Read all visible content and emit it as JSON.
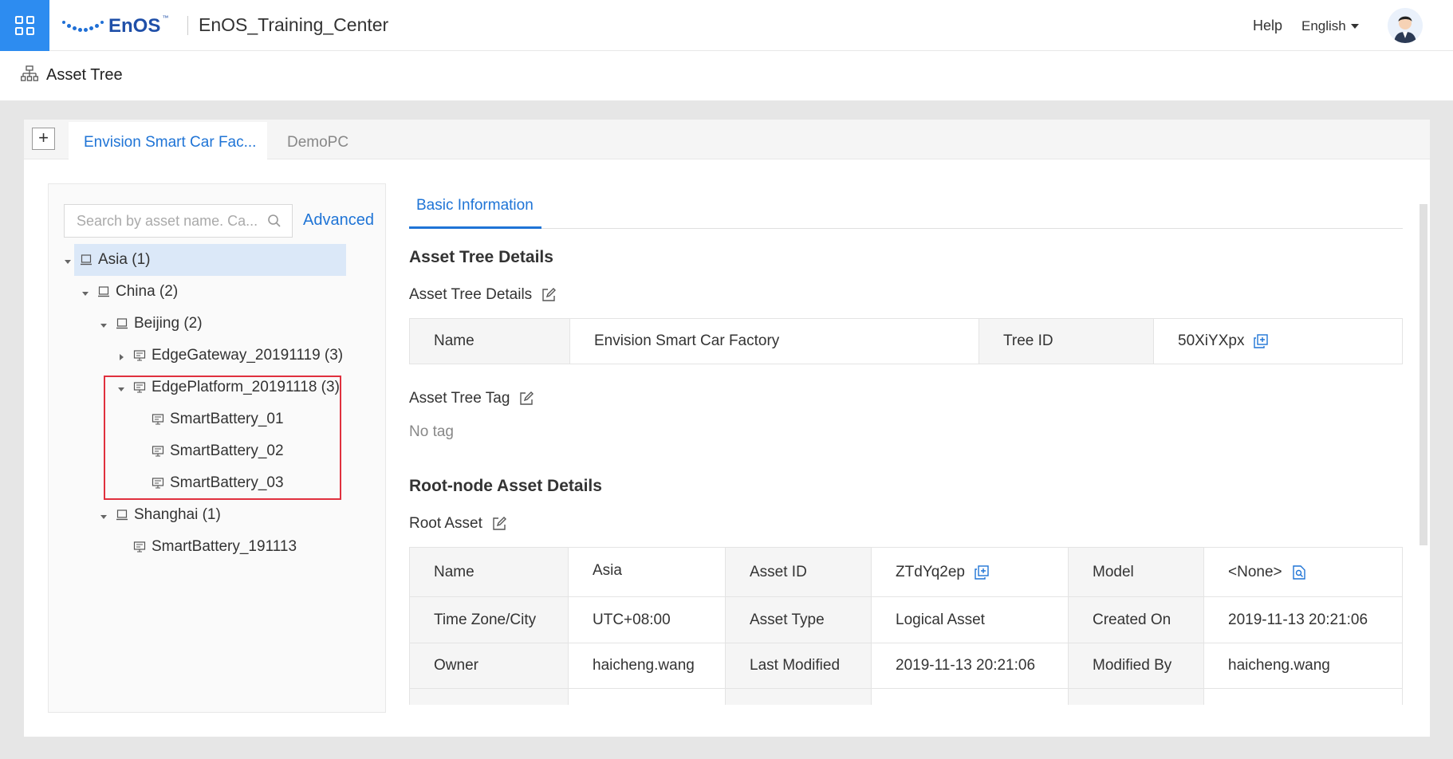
{
  "header": {
    "logo_text": "EnOS",
    "logo_tm": "™",
    "app_title": "EnOS_Training_Center",
    "help": "Help",
    "language": "English"
  },
  "page": {
    "title": "Asset Tree"
  },
  "tree_tabs": [
    {
      "label": "Envision Smart Car Fac...",
      "active": true
    },
    {
      "label": "DemoPC",
      "active": false
    }
  ],
  "add_tab_label": "+",
  "search": {
    "placeholder": "Search by asset name. Ca...",
    "advanced": "Advanced"
  },
  "tree": [
    {
      "label": "Asia (1)",
      "expanded": true,
      "selected": true
    },
    {
      "label": "China (2)",
      "expanded": true
    },
    {
      "label": "Beijing (2)",
      "expanded": true
    },
    {
      "label": "EdgeGateway_20191119 (3)",
      "expanded": false
    },
    {
      "label": "EdgePlatform_20191118 (3)",
      "expanded": true
    },
    {
      "label": "SmartBattery_01"
    },
    {
      "label": "SmartBattery_02"
    },
    {
      "label": "SmartBattery_03"
    },
    {
      "label": "Shanghai (1)",
      "expanded": true
    },
    {
      "label": "SmartBattery_191113"
    }
  ],
  "detail_tab": "Basic Information",
  "asset_tree_details": {
    "section_title": "Asset Tree Details",
    "sub_label": "Asset Tree Details",
    "name_label": "Name",
    "name_value": "Envision Smart Car Factory",
    "tree_id_label": "Tree ID",
    "tree_id_value": "50XiYXpx"
  },
  "asset_tree_tag": {
    "label": "Asset Tree Tag",
    "empty": "No tag"
  },
  "root_node": {
    "section_title": "Root-node Asset Details",
    "sub_label": "Root Asset",
    "rows": [
      [
        "Name",
        "Asia",
        "Asset ID",
        "ZTdYq2ep",
        "Model",
        "<None>"
      ],
      [
        "Time Zone/City",
        "UTC+08:00",
        "Asset Type",
        "Logical Asset",
        "Created On",
        "2019-11-13 20:21:06"
      ],
      [
        "Owner",
        "haicheng.wang",
        "Last Modified",
        "2019-11-13 20:21:06",
        "Modified By",
        "haicheng.wang"
      ]
    ]
  },
  "colors": {
    "accent": "#1f74d6",
    "app_button": "#2d8cf0",
    "highlight_box": "#e0303e",
    "selected_row": "#dbe8f8"
  }
}
